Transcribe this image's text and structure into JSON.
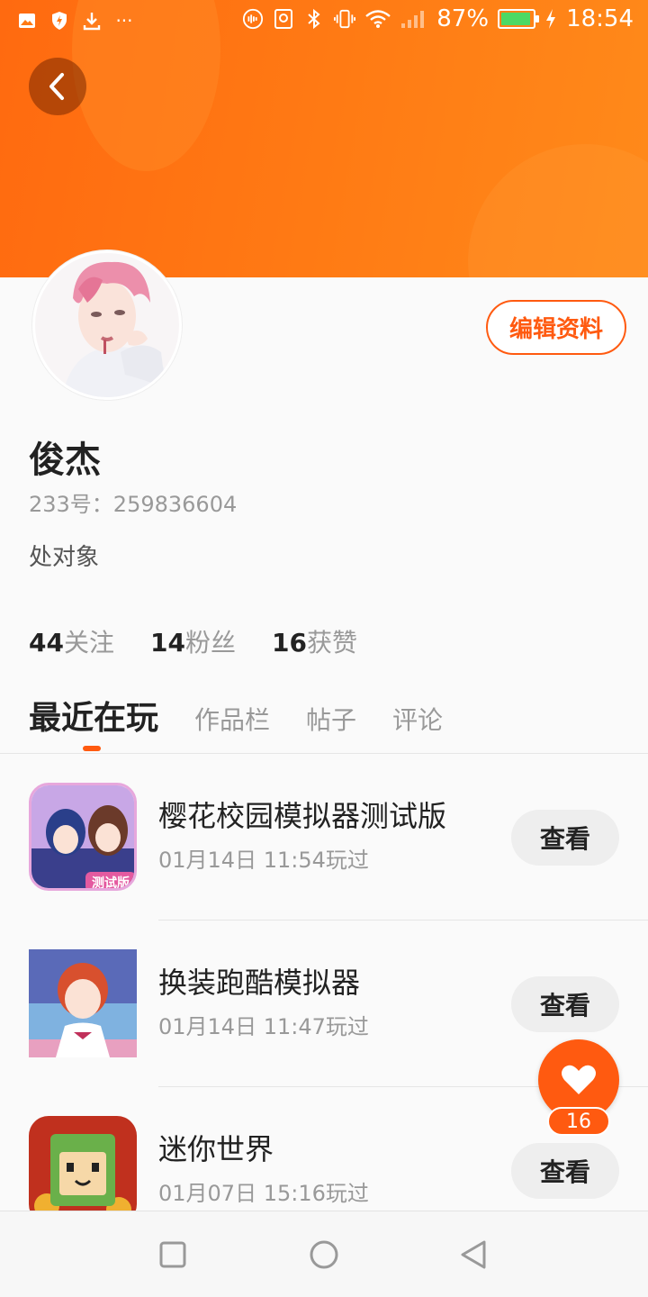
{
  "status_bar": {
    "battery": "87%",
    "time": "18:54",
    "battery_level": 0.87
  },
  "profile": {
    "edit_label": "编辑资料",
    "name": "俊杰",
    "uid": "233号：259836604",
    "bio": "处对象"
  },
  "stats": [
    {
      "num": "44",
      "label": "关注"
    },
    {
      "num": "14",
      "label": "粉丝"
    },
    {
      "num": "16",
      "label": "获赞"
    }
  ],
  "tabs": [
    {
      "label": "最近在玩",
      "active": true
    },
    {
      "label": "作品栏",
      "active": false
    },
    {
      "label": "帖子",
      "active": false
    },
    {
      "label": "评论",
      "active": false
    }
  ],
  "games": [
    {
      "title": "樱花校园模拟器测试版",
      "time": "01月14日 11:54玩过",
      "button": "查看",
      "icon_text": "测试版"
    },
    {
      "title": "换装跑酷模拟器",
      "time": "01月14日 11:47玩过",
      "button": "查看"
    },
    {
      "title": "迷你世界",
      "time": "01月07日 15:16玩过",
      "button": "查看"
    }
  ],
  "likes_fab": {
    "count": "16"
  },
  "colors": {
    "accent": "#ff5a10",
    "header": "#ff7a14"
  }
}
